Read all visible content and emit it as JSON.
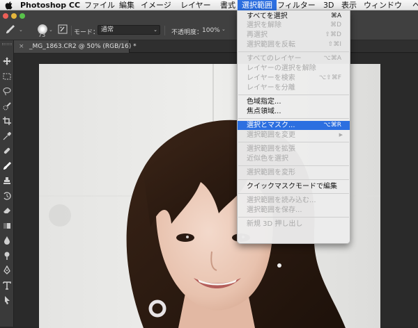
{
  "menubar": {
    "app_name": "Photoshop CC",
    "items": [
      "ファイル",
      "編集",
      "イメージ",
      "レイヤー",
      "書式",
      "選択範囲",
      "フィルター",
      "3D",
      "表示",
      "ウィンドウ",
      "ヘ"
    ],
    "active_index": 5
  },
  "options_bar": {
    "brush_size": "73",
    "mode_label": "モード：",
    "mode_value": "通常",
    "opacity_label": "不透明度：",
    "opacity_value": "100%"
  },
  "document_tab": {
    "close_glyph": "×",
    "title": "_MG_1863.CR2 @ 50% (RGB/16) *"
  },
  "tools": [
    "move-tool-icon",
    "marquee-tool-icon",
    "lasso-tool-icon",
    "quick-selection-tool-icon",
    "crop-tool-icon",
    "eyedropper-tool-icon",
    "healing-brush-tool-icon",
    "brush-tool-icon",
    "clone-stamp-tool-icon",
    "history-brush-tool-icon",
    "eraser-tool-icon",
    "gradient-tool-icon",
    "blur-tool-icon",
    "dodge-tool-icon",
    "pen-tool-icon",
    "type-tool-icon",
    "path-selection-tool-icon"
  ],
  "select_menu": {
    "groups": [
      [
        {
          "label": "すべてを選択",
          "shortcut": "⌘A",
          "enabled": true
        },
        {
          "label": "選択を解除",
          "shortcut": "⌘D",
          "enabled": false
        },
        {
          "label": "再選択",
          "shortcut": "⇧⌘D",
          "enabled": false
        },
        {
          "label": "選択範囲を反転",
          "shortcut": "⇧⌘I",
          "enabled": false
        }
      ],
      [
        {
          "label": "すべてのレイヤー",
          "shortcut": "⌥⌘A",
          "enabled": false
        },
        {
          "label": "レイヤーの選択を解除",
          "shortcut": "",
          "enabled": false
        },
        {
          "label": "レイヤーを検索",
          "shortcut": "⌥⇧⌘F",
          "enabled": false
        },
        {
          "label": "レイヤーを分離",
          "shortcut": "",
          "enabled": false
        }
      ],
      [
        {
          "label": "色域指定...",
          "shortcut": "",
          "enabled": true
        },
        {
          "label": "焦点領域...",
          "shortcut": "",
          "enabled": true
        }
      ],
      [
        {
          "label": "選択とマスク...",
          "shortcut": "⌥⌘R",
          "enabled": true,
          "highlighted": true
        },
        {
          "label": "選択範囲を変更",
          "shortcut": "",
          "enabled": false,
          "submenu": true
        }
      ],
      [
        {
          "label": "選択範囲を拡張",
          "shortcut": "",
          "enabled": false
        },
        {
          "label": "近似色を選択",
          "shortcut": "",
          "enabled": false
        }
      ],
      [
        {
          "label": "選択範囲を変形",
          "shortcut": "",
          "enabled": false
        }
      ],
      [
        {
          "label": "クイックマスクモードで編集",
          "shortcut": "",
          "enabled": true
        }
      ],
      [
        {
          "label": "選択範囲を読み込む...",
          "shortcut": "",
          "enabled": false
        },
        {
          "label": "選択範囲を保存...",
          "shortcut": "",
          "enabled": false
        }
      ],
      [
        {
          "label": "新規 3D 押し出し",
          "shortcut": "",
          "enabled": false
        }
      ]
    ],
    "submenu_glyph": "▶"
  },
  "colors": {
    "menu_highlight": "#2c6fe0",
    "panel_bg": "#404040",
    "canvas_bg": "#2a2a2a"
  }
}
